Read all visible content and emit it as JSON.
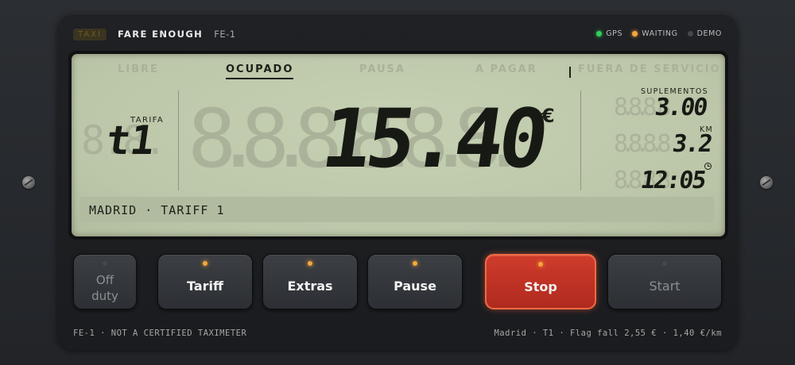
{
  "header": {
    "badge": "TAXI",
    "brand": "FARE ENOUGH",
    "model": "FE-1",
    "indicators": [
      {
        "label": "GPS",
        "color": "#31d05a"
      },
      {
        "label": "WAITING",
        "color": "#f5a63a"
      },
      {
        "label": "DEMO",
        "color": "#44474b"
      }
    ]
  },
  "display": {
    "statuses": [
      "LIBRE",
      "OCUPADO",
      "PAUSA",
      "A PAGAR",
      "FUERA DE SERVICIO"
    ],
    "active_status": "OCUPADO",
    "tariff_label": "TARIFA",
    "tariff_value": "t1",
    "tariff_ghost": "8.8.",
    "fare": "15.40",
    "fare_ghost": "8.8.8.8.8.8.",
    "currency": "€",
    "supplements_label": "SUPLEMENTOS",
    "supplements": "3.00",
    "supplements_ghost": "8.8.8.8",
    "km_label": "KM",
    "km": "3.2",
    "km_ghost": "8.8.8.8",
    "time": "12:05",
    "time_ghost": "8.8.8.8",
    "footer": "MADRID · TARIFF 1"
  },
  "buttons": [
    {
      "label_line1": "Off",
      "label_line2": "duty",
      "led": "off"
    },
    {
      "label": "Tariff",
      "led": "on"
    },
    {
      "label": "Extras",
      "led": "on"
    },
    {
      "label": "Pause",
      "led": "on"
    },
    {
      "label": "Stop",
      "led": "on"
    },
    {
      "label": "Start",
      "led": "off"
    }
  ],
  "footer": {
    "left": "FE-1 · NOT A CERTIFIED TAXIMETER",
    "right": "Madrid · T1 · Flag fall 2,55 € · 1,40 €/km"
  }
}
